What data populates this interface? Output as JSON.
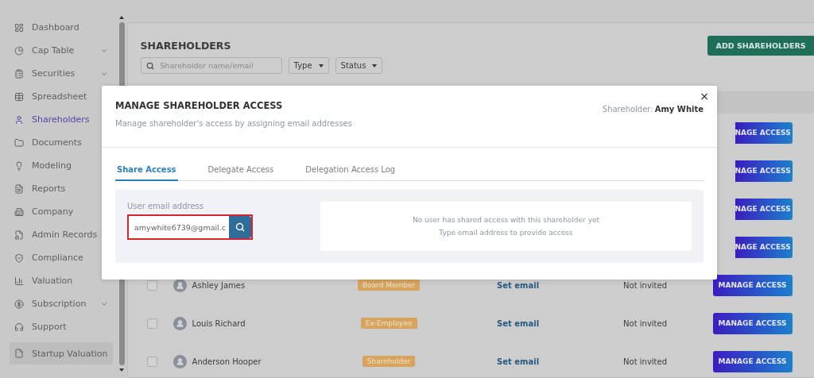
{
  "sidebar": {
    "items": [
      {
        "label": "Dashboard",
        "selected": false,
        "expandable": false,
        "kind": "link"
      },
      {
        "label": "Cap Table",
        "selected": false,
        "expandable": true,
        "kind": "link"
      },
      {
        "label": "Securities",
        "selected": false,
        "expandable": true,
        "kind": "link"
      },
      {
        "label": "Spreadsheet",
        "selected": false,
        "expandable": false,
        "kind": "link"
      },
      {
        "label": "Shareholders",
        "selected": true,
        "expandable": false,
        "kind": "link"
      },
      {
        "label": "Documents",
        "selected": false,
        "expandable": false,
        "kind": "link"
      },
      {
        "label": "Modeling",
        "selected": false,
        "expandable": false,
        "kind": "link"
      },
      {
        "label": "Reports",
        "selected": false,
        "expandable": false,
        "kind": "link"
      },
      {
        "label": "Company",
        "selected": false,
        "expandable": false,
        "kind": "link"
      },
      {
        "label": "Admin Records",
        "selected": false,
        "expandable": false,
        "kind": "link"
      },
      {
        "label": "Compliance",
        "selected": false,
        "expandable": false,
        "kind": "link"
      },
      {
        "label": "Valuation",
        "selected": false,
        "expandable": false,
        "kind": "link"
      },
      {
        "label": "Subscription",
        "selected": false,
        "expandable": true,
        "kind": "link"
      },
      {
        "label": "Support",
        "selected": false,
        "expandable": false,
        "kind": "link"
      },
      {
        "label": "Startup Valuation",
        "selected": false,
        "expandable": false,
        "kind": "pinned"
      }
    ]
  },
  "page": {
    "title": "SHAREHOLDERS",
    "add_button": "ADD SHAREHOLDERS",
    "search": {
      "placeholder": "Shareholder name/email"
    },
    "filters": [
      "Type",
      "Status"
    ],
    "rows": [
      {
        "kind": "covered",
        "action": "NAGE ACCESS"
      },
      {
        "kind": "covered",
        "action": "NAGE ACCESS"
      },
      {
        "kind": "covered",
        "action": "NAGE ACCESS"
      },
      {
        "kind": "covered",
        "action": "NAGE ACCESS"
      },
      {
        "kind": "full",
        "name": "Ashley James",
        "tag": "Board Member",
        "email": "Set email",
        "status": "Not invited",
        "action": "MANAGE ACCESS",
        "checked": false
      },
      {
        "kind": "full",
        "name": "Louis Richard",
        "tag": "Ex-Employee",
        "email": "Set email",
        "status": "Not invited",
        "action": "MANAGE ACCESS",
        "checked": false
      },
      {
        "kind": "full",
        "name": "Anderson Hooper",
        "tag": "Shareholder",
        "email": "Set email",
        "status": "Not invited",
        "action": "MANAGE ACCESS",
        "checked": false
      }
    ]
  },
  "modal": {
    "title": "MANAGE SHAREHOLDER ACCESS",
    "subtitle": "Manage shareholder's access by assigning email addresses",
    "close": "×",
    "shareholder_label": "Shareholder:",
    "shareholder_name": "Amy White",
    "tabs": [
      {
        "label": "Share Access",
        "selected": true
      },
      {
        "label": "Delegate Access",
        "selected": false
      },
      {
        "label": "Delegation Access Log",
        "selected": false
      }
    ],
    "email_field": {
      "label": "User email address",
      "value": "amywhite6739@gmail.c"
    },
    "empty_message": [
      "No user has shared access with this shareholder yet",
      "Type email address to provide access"
    ]
  }
}
